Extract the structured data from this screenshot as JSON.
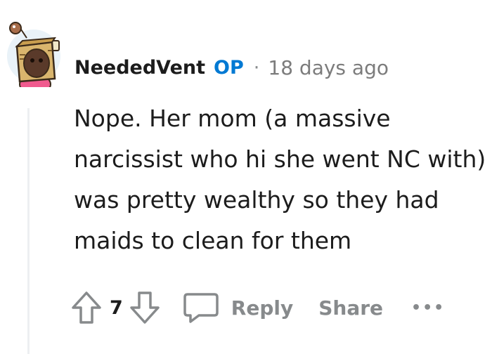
{
  "comment": {
    "author": "NeededVent",
    "op_badge": "OP",
    "separator": "·",
    "timestamp": "18 days ago",
    "body": "Nope. Her mom (a massive narcissist who hi she went NC with) was pretty wealthy so they had maids to clean for them",
    "score": "7"
  },
  "actions": {
    "reply_label": "Reply",
    "share_label": "Share",
    "more_label": "•••"
  },
  "icons": {
    "avatar": "snoo-box-head-avatar",
    "upvote": "upvote-arrow-icon",
    "downvote": "downvote-arrow-icon",
    "reply": "speech-bubble-icon",
    "more": "ellipsis-icon"
  },
  "colors": {
    "op_badge": "#0079d3",
    "muted": "#878a8c",
    "text": "#1c1c1c",
    "thread_line": "#edeff1"
  }
}
